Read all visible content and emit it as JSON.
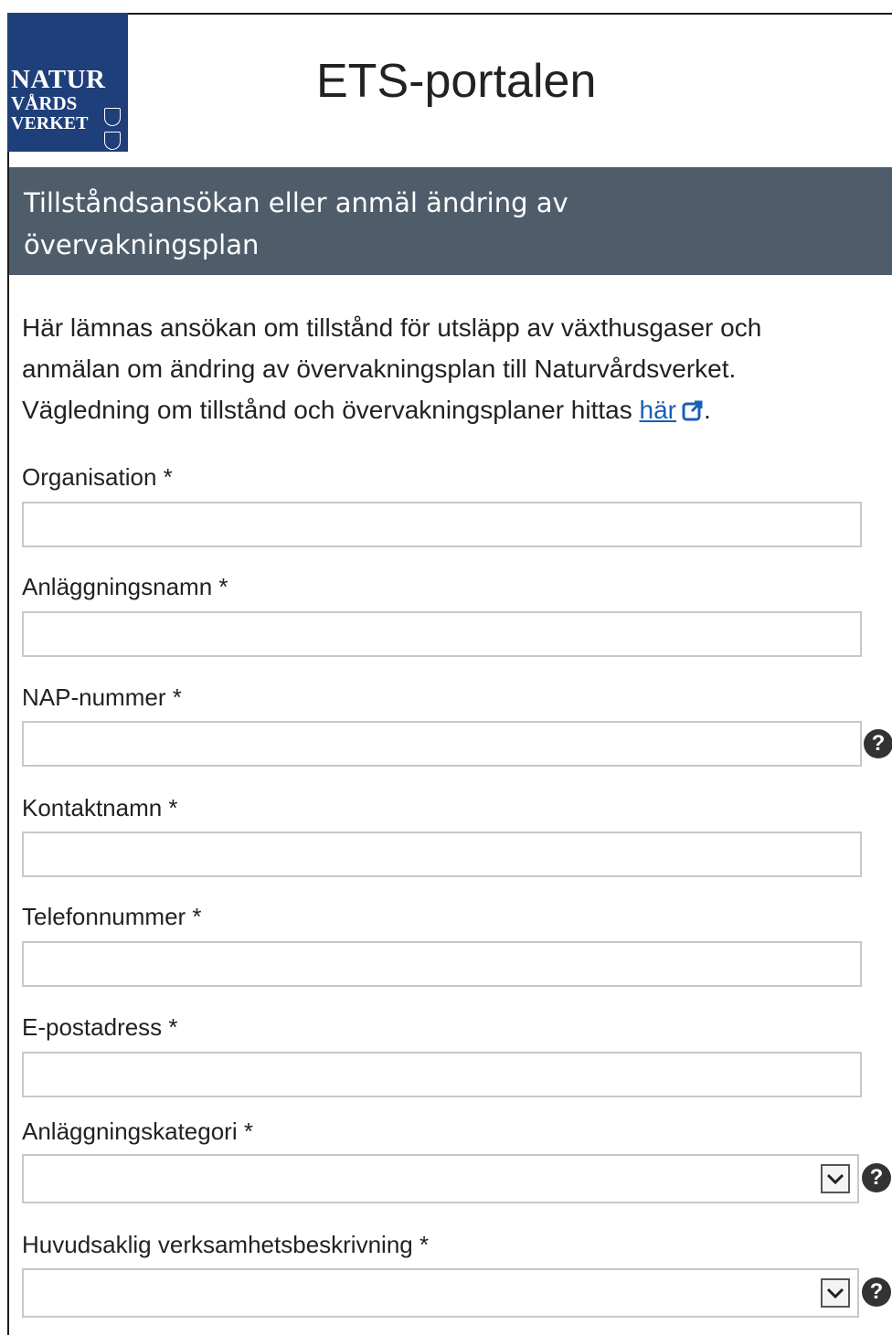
{
  "header": {
    "logo": {
      "line1": "NATUR",
      "line2": "VÅRDS",
      "line3": "VERKET"
    },
    "app_title": "ETS-portalen"
  },
  "banner": {
    "title_line1": "Tillståndsansökan eller anmäl ändring av",
    "title_line2": "övervakningsplan",
    "background_color": "#4f5d6b"
  },
  "intro": {
    "text_line1": "Här lämnas ansökan om tillstånd för utsläpp av växthusgaser och",
    "text_line2": "anmälan om ändring av övervakningsplan till Naturvårdsverket.",
    "text_line3_before_link": "Vägledning om tillstånd och övervakningsplaner hittas ",
    "link_text": "här",
    "link_icon": "external-link-icon",
    "text_after_link": "."
  },
  "form": {
    "organisation": {
      "label": "Organisation *",
      "value": "",
      "placeholder": ""
    },
    "anlaggningsnamn": {
      "label": "Anläggningsnamn *",
      "value": "",
      "placeholder": ""
    },
    "nap_nummer": {
      "label": "NAP-nummer *",
      "value": "",
      "placeholder": "",
      "help_icon": "help-icon",
      "help_glyph": "?"
    },
    "kontaktnamn": {
      "label": "Kontaktnamn *",
      "value": "",
      "placeholder": ""
    },
    "telefonnummer": {
      "label": "Telefonnummer *",
      "value": "",
      "placeholder": ""
    },
    "e_postadress": {
      "label": "E-postadress *",
      "value": "",
      "placeholder": ""
    },
    "anlaggningskategori": {
      "label": "Anläggningskategori *",
      "selected": "",
      "help_icon": "help-icon",
      "help_glyph": "?"
    },
    "verksamhetsbeskrivning": {
      "label": "Huvudsaklig verksamhetsbeskrivning *",
      "selected": "",
      "help_icon": "help-icon",
      "help_glyph": "?"
    }
  },
  "colors": {
    "logo_background": "#1f3f7a",
    "link": "#1a5fb4",
    "input_border": "#c8c8c8"
  }
}
